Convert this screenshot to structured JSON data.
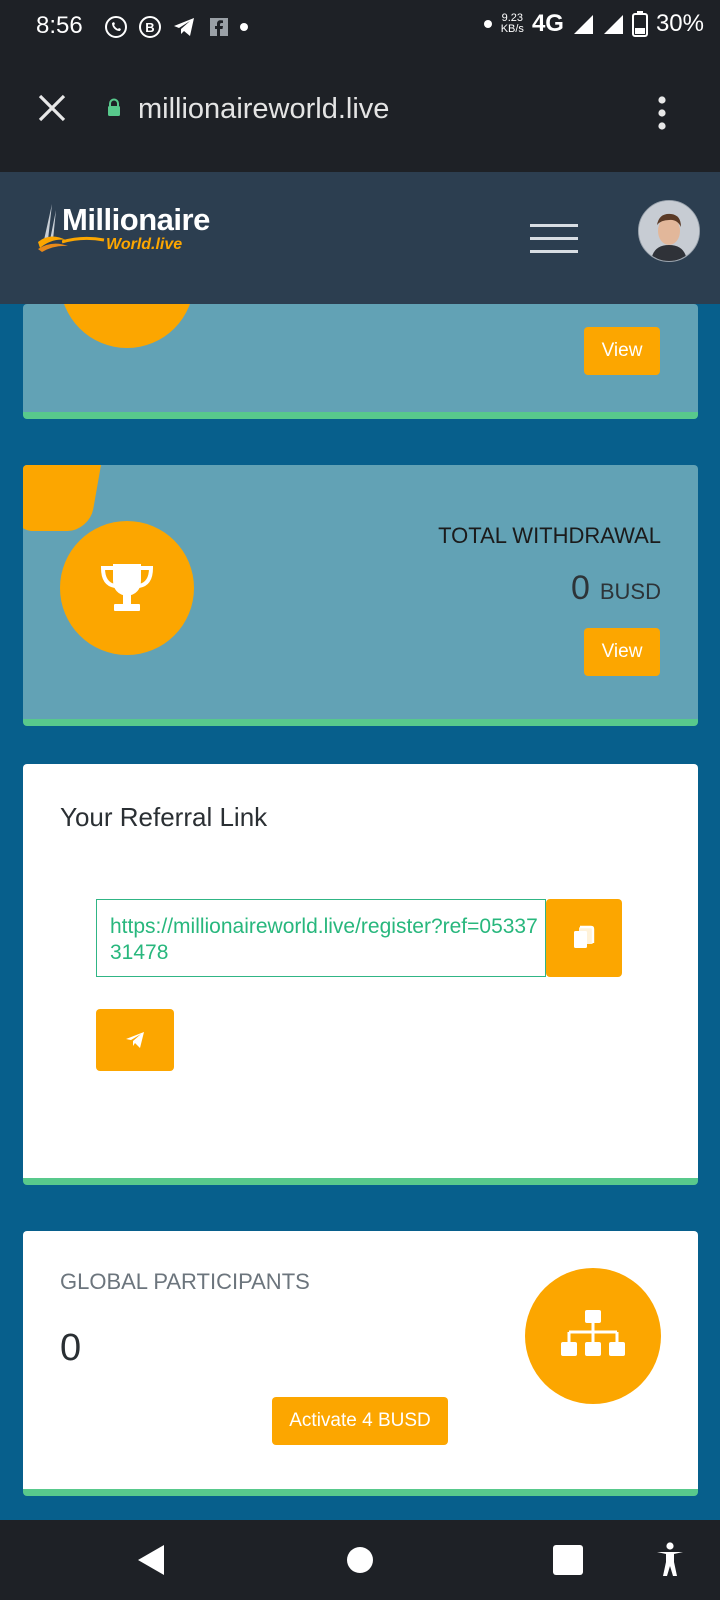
{
  "status_bar": {
    "time": "8:56",
    "speed_value": "9.23",
    "speed_unit": "KB/s",
    "network": "4G",
    "battery": "30%",
    "notification_icons": [
      "whatsapp-icon",
      "whatsapp-business-icon",
      "telegram-icon",
      "facebook-icon",
      "dot-icon"
    ]
  },
  "browser": {
    "url": "millionaireworld.live"
  },
  "header": {
    "logo_line1": "Millionaire",
    "logo_line2": "World.live"
  },
  "cards": {
    "top_card": {
      "view_label": "View"
    },
    "withdrawal": {
      "title": "TOTAL WITHDRAWAL",
      "amount": "0",
      "currency": "BUSD",
      "view_label": "View"
    },
    "referral": {
      "title": "Your Referral Link",
      "link": "https://millionaireworld.live/register?ref=0533731478"
    },
    "participants": {
      "title": "GLOBAL PARTICIPANTS",
      "count": "0",
      "activate_label": "Activate 4 BUSD"
    }
  },
  "colors": {
    "accent": "#fca600",
    "page_bg": "#075f8c",
    "card_blue": "#62a2b5",
    "success_border": "#58c98c",
    "link_green": "#28b77d"
  }
}
